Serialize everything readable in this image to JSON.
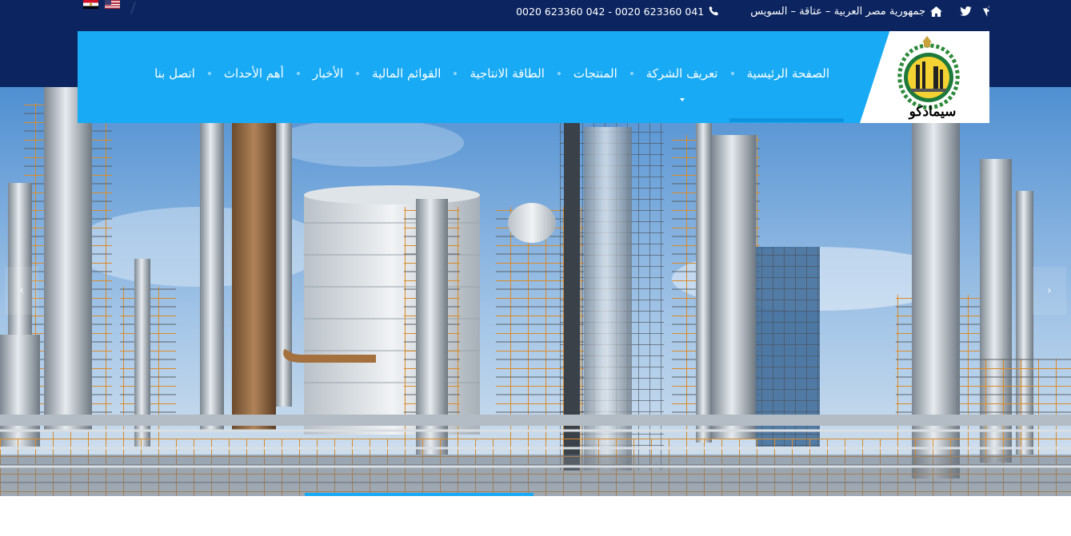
{
  "topbar": {
    "flags": [
      "egypt-flag",
      "us-flag"
    ],
    "address": "جمهورية مصر العربية – عتاقة – السويس",
    "phones": "0020 623360 042 - 0020 623360 041",
    "social": [
      "facebook-icon",
      "twitter-icon"
    ]
  },
  "nav": {
    "logo_text": "سيمادكو",
    "items": [
      {
        "label": "الصفحة الرئيسية"
      },
      {
        "label": "تعريف الشركة"
      },
      {
        "label": "المنتجات"
      },
      {
        "label": "الطاقة الانتاجية"
      },
      {
        "label": "القوائم المالية"
      },
      {
        "label": "الأخبار"
      },
      {
        "label": "أهم الأحداث"
      },
      {
        "label": "اتصل بنا"
      }
    ]
  },
  "hero": {
    "slider_prev": "‹",
    "slider_next": "›"
  },
  "colors": {
    "topbar": "#0c2560",
    "nav": "#18aaf5",
    "accent": "#0d94e0"
  }
}
